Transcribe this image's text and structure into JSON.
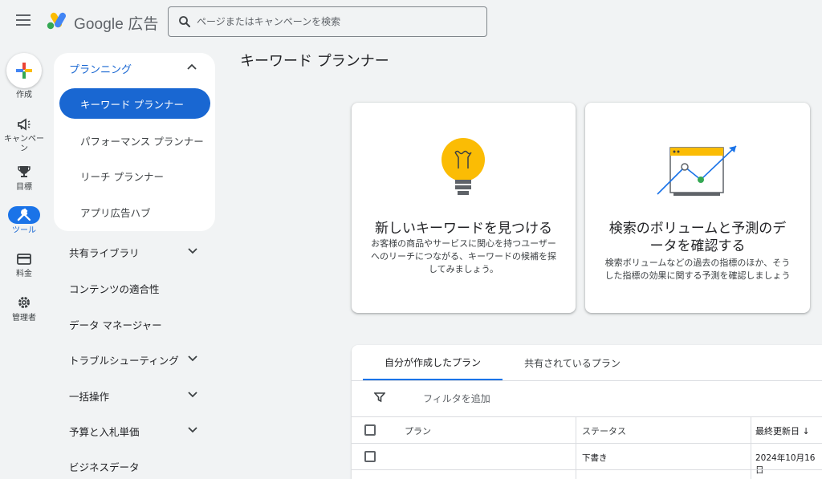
{
  "header": {
    "brand_name": "Google 広告",
    "search_placeholder": "ページまたはキャンペーンを検索"
  },
  "rail": {
    "create": "作成",
    "campaigns": "キャンペーン",
    "goals": "目標",
    "tools": "ツール",
    "billing": "料金",
    "admin": "管理者"
  },
  "nav": {
    "planning": "プランニング",
    "planning_items": [
      "キーワード プランナー",
      "パフォーマンス プランナー",
      "リーチ プランナー",
      "アプリ広告ハブ"
    ],
    "groups": [
      "共有ライブラリ",
      "コンテンツの適合性",
      "データ マネージャー",
      "トラブルシューティング",
      "一括操作",
      "予算と入札単価",
      "ビジネスデータ"
    ]
  },
  "main": {
    "page_title": "キーワード プランナー",
    "cards": [
      {
        "title": "新しいキーワードを見つける",
        "desc_lines": [
          "お客様の商品やサービスに関心を持つユーザー",
          "へのリーチにつながる、キーワードの候補を探",
          "してみましょう。"
        ]
      },
      {
        "title_lines": [
          "検索のボリュームと予測のデ",
          "ータを確認する"
        ],
        "desc_lines": [
          "検索ボリュームなどの過去の指標のほか、そう",
          "した指標の効果に関する予測を確認しましょう"
        ]
      }
    ]
  },
  "plans": {
    "tabs": [
      "自分が作成したプラン",
      "共有されているプラン"
    ],
    "filter_label": "フィルタを追加",
    "columns": [
      "プラン",
      "ステータス",
      "最終更新日"
    ],
    "sort_arrow": "↓",
    "rows": [
      {
        "plan": "",
        "status": "下書き",
        "updated": "2024年10月16日"
      }
    ]
  },
  "colors": {
    "accent": "#1967d2",
    "bulb": "#fbbc04",
    "green": "#34a853"
  }
}
